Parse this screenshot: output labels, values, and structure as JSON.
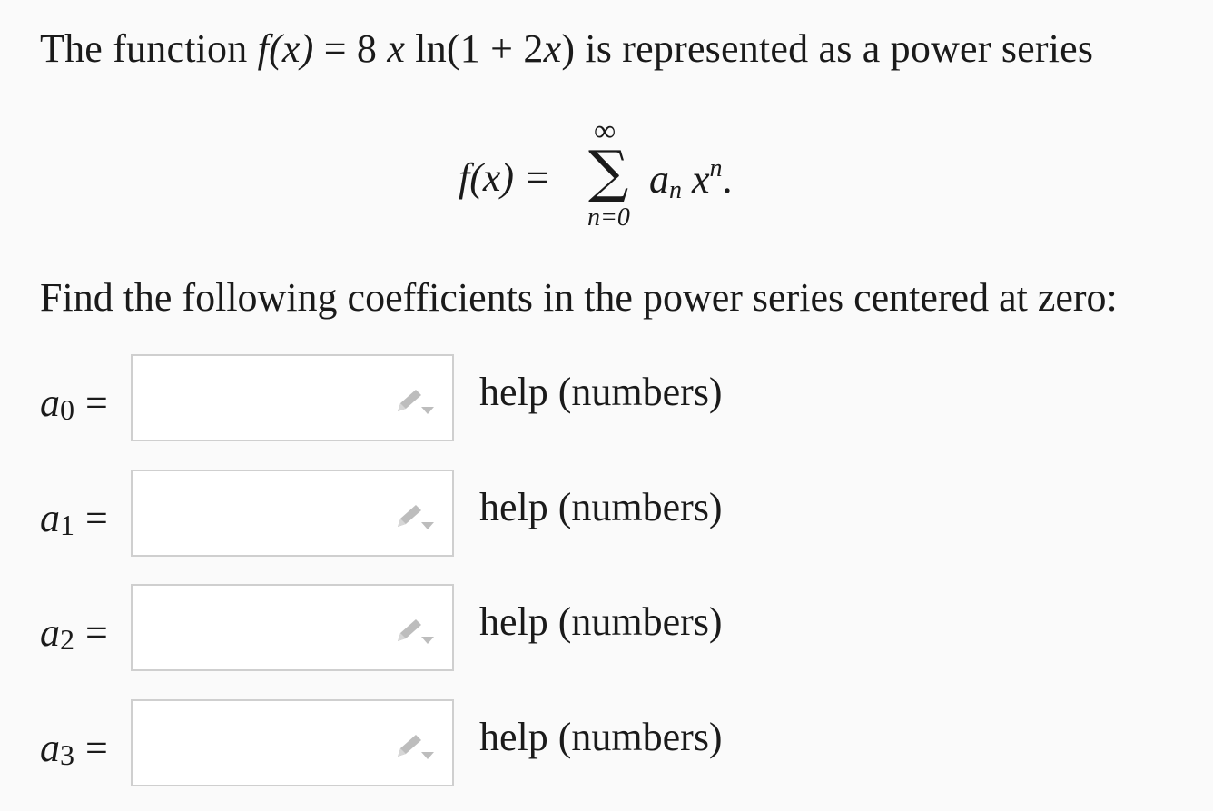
{
  "intro": {
    "prefix": "The function ",
    "f": "f",
    "x_paren": "(x)",
    "eq": " = 8 ",
    "x2": "x",
    "ln": " ln(1 + 2",
    "x3": "x",
    "suffix": ") is represented as a power series"
  },
  "series": {
    "lhs": "f(x) =",
    "sigma": "∑",
    "upper": "∞",
    "lower": "n=0",
    "a": "a",
    "a_sub": "n",
    "x": " x",
    "x_sup": "n",
    "period": "."
  },
  "instruction": "Find the following coefficients in the power series centered at zero:",
  "rows": [
    {
      "var": "a",
      "index": "0",
      "eq": "=",
      "value": "",
      "help": "help (numbers)"
    },
    {
      "var": "a",
      "index": "1",
      "eq": "=",
      "value": "",
      "help": "help (numbers)"
    },
    {
      "var": "a",
      "index": "2",
      "eq": "=",
      "value": "",
      "help": "help (numbers)"
    },
    {
      "var": "a",
      "index": "3",
      "eq": "=",
      "value": "",
      "help": "help (numbers)"
    }
  ],
  "colors": {
    "background": "#fafafa",
    "box_border": "#cfcfcf",
    "pencil": "#bdbdbd"
  },
  "icons": {
    "answer_field": "pencil-dropdown-icon"
  }
}
